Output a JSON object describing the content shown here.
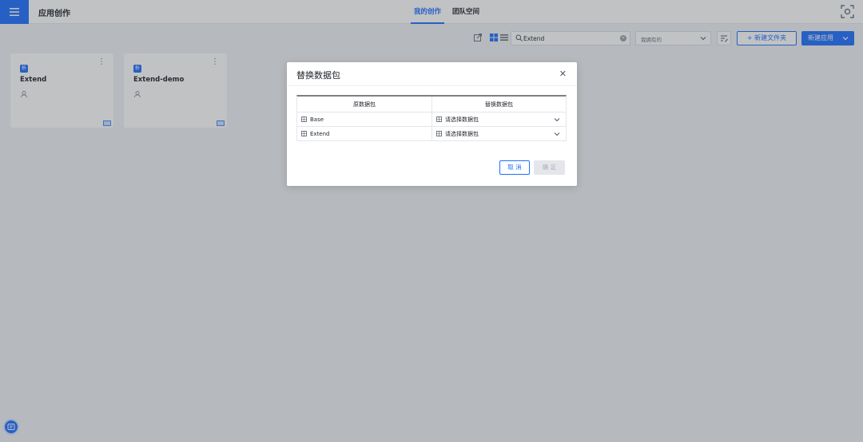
{
  "header": {
    "app_title": "应用创作",
    "tabs": [
      {
        "label": "我的创作",
        "active": true
      },
      {
        "label": "团队空间",
        "active": false
      }
    ]
  },
  "toolbar": {
    "search_value": "Extend",
    "filter_select_value": "我拥有的",
    "new_folder_label": "新建文件夹",
    "new_app_label": "新建应用"
  },
  "cards": [
    {
      "badge": "析",
      "name": "Extend"
    },
    {
      "badge": "析",
      "name": "Extend-demo"
    }
  ],
  "modal": {
    "title": "替换数据包",
    "columns": [
      "原数据包",
      "替换数据包"
    ],
    "rows": [
      {
        "source": "Base",
        "target_placeholder": "请选择数据包"
      },
      {
        "source": "Extend",
        "target_placeholder": "请选择数据包"
      }
    ],
    "cancel_label": "取 消",
    "ok_label": "确 定"
  },
  "colors": {
    "accent": "#1e6fff",
    "background": "#f0f2f5",
    "overlay": "rgba(60,64,72,0.32)"
  },
  "icons": [
    "menu-icon",
    "scan-icon",
    "export-icon",
    "grid-view-icon",
    "list-view-icon",
    "search-icon",
    "clear-icon",
    "chevron-down-icon",
    "sort-icon",
    "plus-icon",
    "more-icon",
    "user-icon",
    "monitor-icon",
    "dataset-icon",
    "close-icon",
    "chat-icon"
  ]
}
